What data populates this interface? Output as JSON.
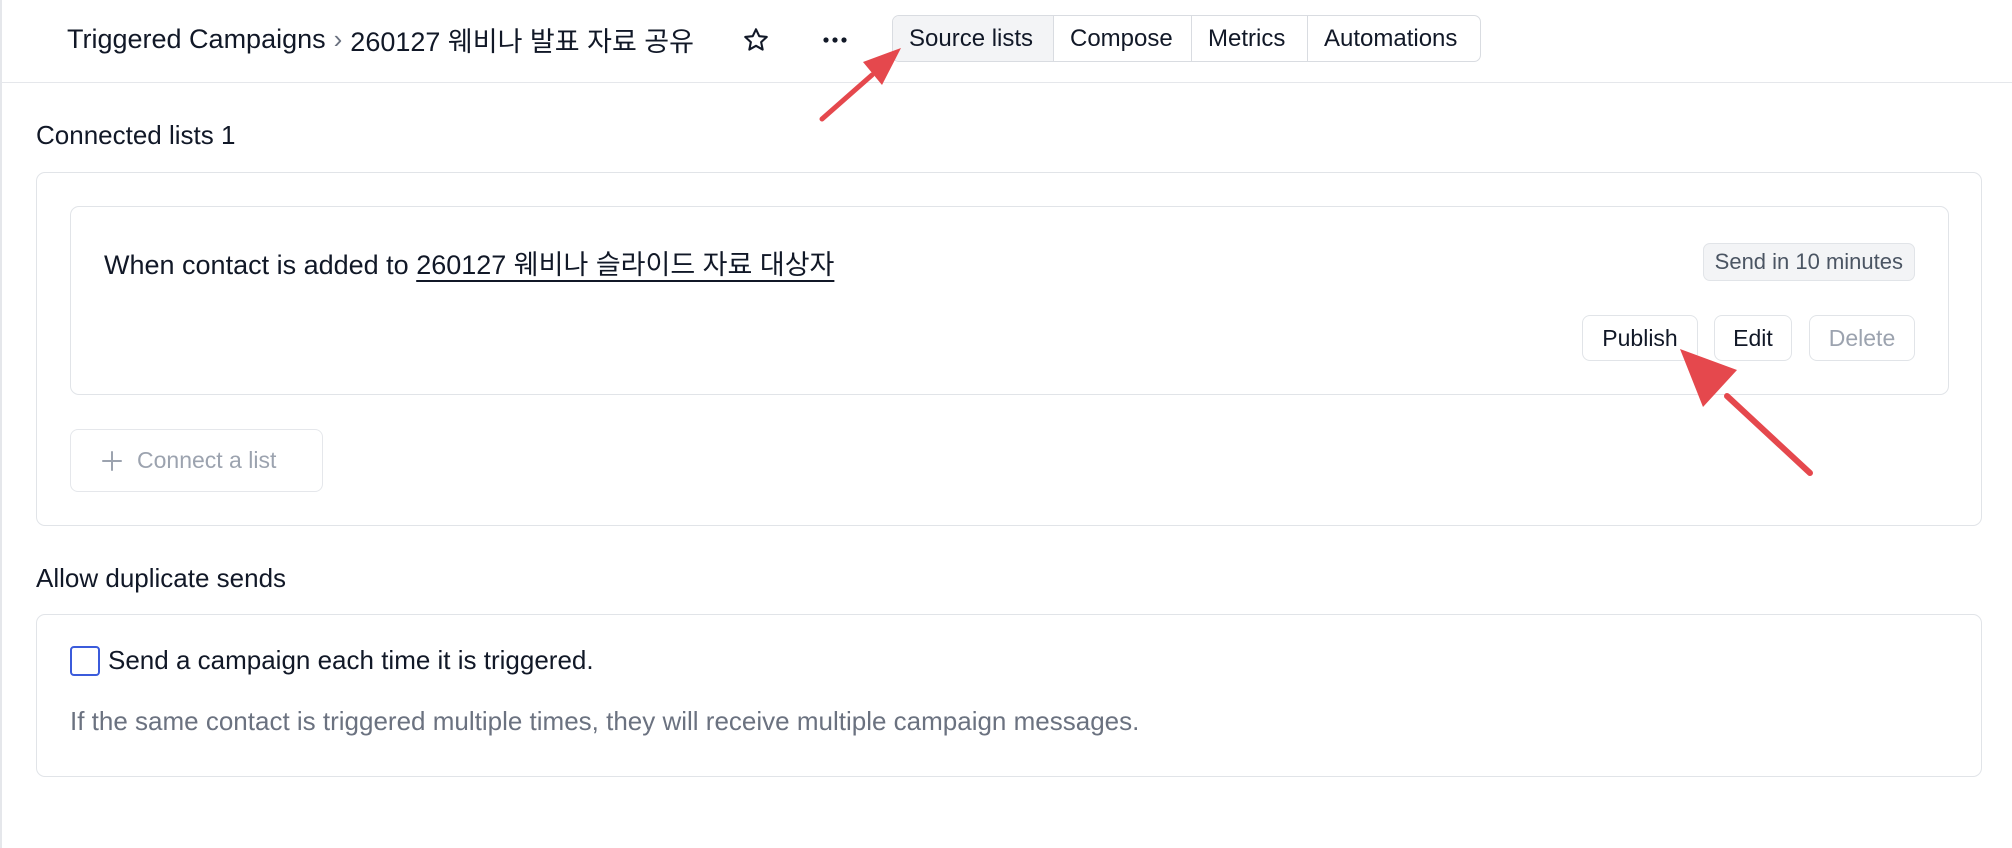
{
  "header": {
    "breadcrumb": {
      "parent": "Triggered Campaigns",
      "separator": "›",
      "current": "260127 웨비나 발표 자료 공유"
    },
    "icons": {
      "favorite": "star-icon",
      "more": "more-horizontal-icon"
    },
    "tabs": [
      {
        "label": "Source lists",
        "active": true
      },
      {
        "label": "Compose",
        "active": false
      },
      {
        "label": "Metrics",
        "active": false
      },
      {
        "label": "Automations",
        "active": false
      }
    ]
  },
  "connected_lists": {
    "title": "Connected lists 1",
    "trigger": {
      "prefix": "When contact is added to",
      "list_name": "260127 웨비나 슬라이드 자료 대상자",
      "delay_badge": "Send in 10 minutes",
      "actions": {
        "publish": "Publish",
        "edit": "Edit",
        "delete": "Delete"
      }
    },
    "connect_button": "Connect a list",
    "connect_icon": "plus-icon"
  },
  "duplicates": {
    "title": "Allow duplicate sends",
    "checkbox_label": "Send a campaign each time it is triggered.",
    "checked": false,
    "helper": "If the same contact is triggered multiple times, they will receive multiple campaign messages."
  },
  "colors": {
    "annotation_arrow": "#e5484d",
    "checkbox_border": "#3b5bdb",
    "muted_text": "#6b7280"
  }
}
